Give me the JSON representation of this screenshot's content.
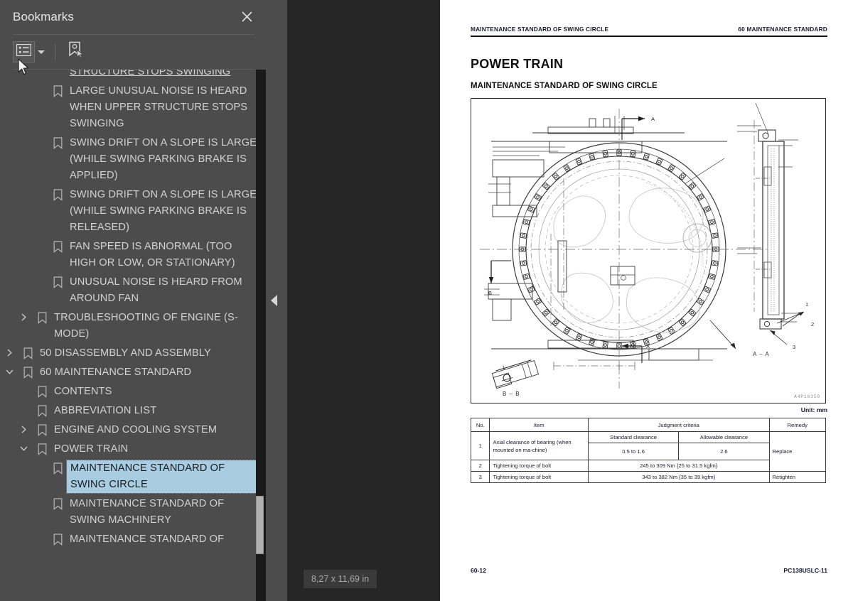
{
  "sidebar": {
    "title": "Bookmarks",
    "close_icon": "close-icon",
    "toolbar": {
      "options_button_label": "Bookmark options",
      "options_icon": "list-options-icon",
      "dropdown_icon": "chevron-down-icon",
      "new_bookmark_icon": "new-bookmark-icon",
      "new_bookmark_label": "New bookmark"
    },
    "tree": [
      {
        "label": "STRUCTURE STOPS SWINGING",
        "indent": 3,
        "twisty": "none",
        "bookmark": false,
        "partial": true,
        "selected": false
      },
      {
        "label": "LARGE UNUSUAL NOISE IS HEARD WHEN UPPER STRUCTURE STOPS SWINGING",
        "indent": 3,
        "twisty": "none",
        "bookmark": true,
        "selected": false
      },
      {
        "label": "SWING DRIFT ON A SLOPE IS LARGE (WHILE SWING PARKING BRAKE IS APPLIED)",
        "indent": 3,
        "twisty": "none",
        "bookmark": true,
        "selected": false
      },
      {
        "label": "SWING DRIFT ON A SLOPE IS LARGE (WHILE SWING PARKING BRAKE IS RELEASED)",
        "indent": 3,
        "twisty": "none",
        "bookmark": true,
        "selected": false
      },
      {
        "label": "FAN SPEED IS ABNORMAL (TOO HIGH OR LOW, OR STATIONARY)",
        "indent": 3,
        "twisty": "none",
        "bookmark": true,
        "selected": false
      },
      {
        "label": "UNUSUAL NOISE IS HEARD FROM AROUND FAN",
        "indent": 3,
        "twisty": "none",
        "bookmark": true,
        "selected": false
      },
      {
        "label": "TROUBLESHOOTING OF ENGINE (S-MODE)",
        "indent": 2,
        "twisty": "collapsed",
        "bookmark": true,
        "selected": false
      },
      {
        "label": "50 DISASSEMBLY AND ASSEMBLY",
        "indent": 1,
        "twisty": "collapsed",
        "bookmark": true,
        "selected": false
      },
      {
        "label": "60 MAINTENANCE STANDARD",
        "indent": 1,
        "twisty": "expanded",
        "bookmark": true,
        "selected": false
      },
      {
        "label": "CONTENTS",
        "indent": 2,
        "twisty": "none",
        "bookmark": true,
        "selected": false
      },
      {
        "label": "ABBREVIATION LIST",
        "indent": 2,
        "twisty": "none",
        "bookmark": true,
        "selected": false
      },
      {
        "label": "ENGINE AND COOLING SYSTEM",
        "indent": 2,
        "twisty": "collapsed",
        "bookmark": true,
        "selected": false
      },
      {
        "label": "POWER TRAIN",
        "indent": 2,
        "twisty": "expanded",
        "bookmark": true,
        "selected": false
      },
      {
        "label": "MAINTENANCE STANDARD OF SWING CIRCLE",
        "indent": 3,
        "twisty": "none",
        "bookmark": true,
        "selected": true
      },
      {
        "label": "MAINTENANCE STANDARD OF SWING MACHINERY",
        "indent": 3,
        "twisty": "none",
        "bookmark": true,
        "selected": false
      },
      {
        "label": "MAINTENANCE STANDARD OF",
        "indent": 3,
        "twisty": "none",
        "bookmark": true,
        "selected": false
      }
    ]
  },
  "gutter": {
    "collapse_icon": "collapse-left-arrow-icon"
  },
  "viewer": {
    "page_size_badge": "8,27 x 11,69 in",
    "page": {
      "header_left": "MAINTENANCE STANDARD OF SWING CIRCLE",
      "header_right": "60 MAINTENANCE STANDARD",
      "section_title": "POWER TRAIN",
      "sub_title": "MAINTENANCE STANDARD OF SWING CIRCLE",
      "figure_code": "A4P16350",
      "figure_labels": {
        "section_a_top": "A",
        "section_a_bottom": "A",
        "section_b_left": "B",
        "detail_bb": "B – B",
        "detail_aa": "A – A",
        "callout_1": "1",
        "callout_2": "2",
        "callout_3": "3"
      },
      "unit_label": "Unit: mm",
      "table": {
        "headers": [
          "No.",
          "Item",
          "Judgment criteria",
          "Remedy"
        ],
        "sub_headers": [
          "Standard clearance",
          "Allowable clearance"
        ],
        "rows": [
          {
            "no": "1",
            "item": "Axial clearance of bearing (when mounted on ma-chine)",
            "standard": "0.5 to 1.6",
            "allowable": "2.6",
            "remedy": "Replace"
          },
          {
            "no": "2",
            "item": "Tightening torque of bolt",
            "criteria": "245 to 309 Nm {25 to 31.5 kgfm}",
            "remedy": "Retighten"
          },
          {
            "no": "3",
            "item": "Tightening torque of bolt",
            "criteria": "343 to 382 Nm {35 to 39 kgfm}",
            "remedy": ""
          }
        ]
      },
      "footer_left": "60-12",
      "footer_right": "PC138USLC-11"
    }
  },
  "colors": {
    "sidebar_bg": "#4c4c4c",
    "viewer_bg": "#262626",
    "selection": "#a8cde3",
    "text": "#d2d2d2",
    "page_bg": "#ffffff"
  }
}
